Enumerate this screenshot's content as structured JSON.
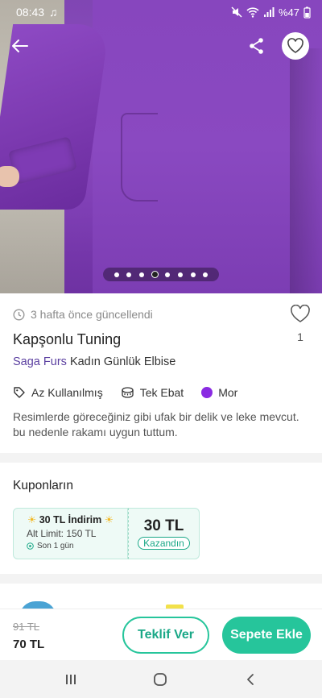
{
  "status_bar": {
    "time": "08:43",
    "battery": "%47"
  },
  "photo": {
    "page_count": 8,
    "active_index": 3
  },
  "listing": {
    "updated": "3 hafta önce güncellendi",
    "like_count": "1",
    "title": "Kapşonlu Tuning",
    "brand": "Saga Furs",
    "category": "Kadın Günlük Elbise",
    "condition": "Az Kullanılmış",
    "size": "Tek Ebat",
    "color_name": "Mor",
    "color_hex": "#8a2be2",
    "description": "Resimlerde göreceğiniz gibi ufak bir delik ve leke mevcut. bu nedenle rakamı uygun tuttum."
  },
  "coupons": {
    "title": "Kuponların",
    "coupon": {
      "sun_left": "☀",
      "discount": "30 TL İndirim",
      "sun_right": "☀",
      "min_limit": "Alt Limit: 150 TL",
      "time_left": "Son 1 gün",
      "amount": "30 TL",
      "won_label": "Kazandın"
    }
  },
  "purchase": {
    "old_price": "91 TL",
    "price": "70 TL",
    "offer_label": "Teklif Ver",
    "cart_label": "Sepete Ekle",
    "accent": "#26c59b"
  }
}
